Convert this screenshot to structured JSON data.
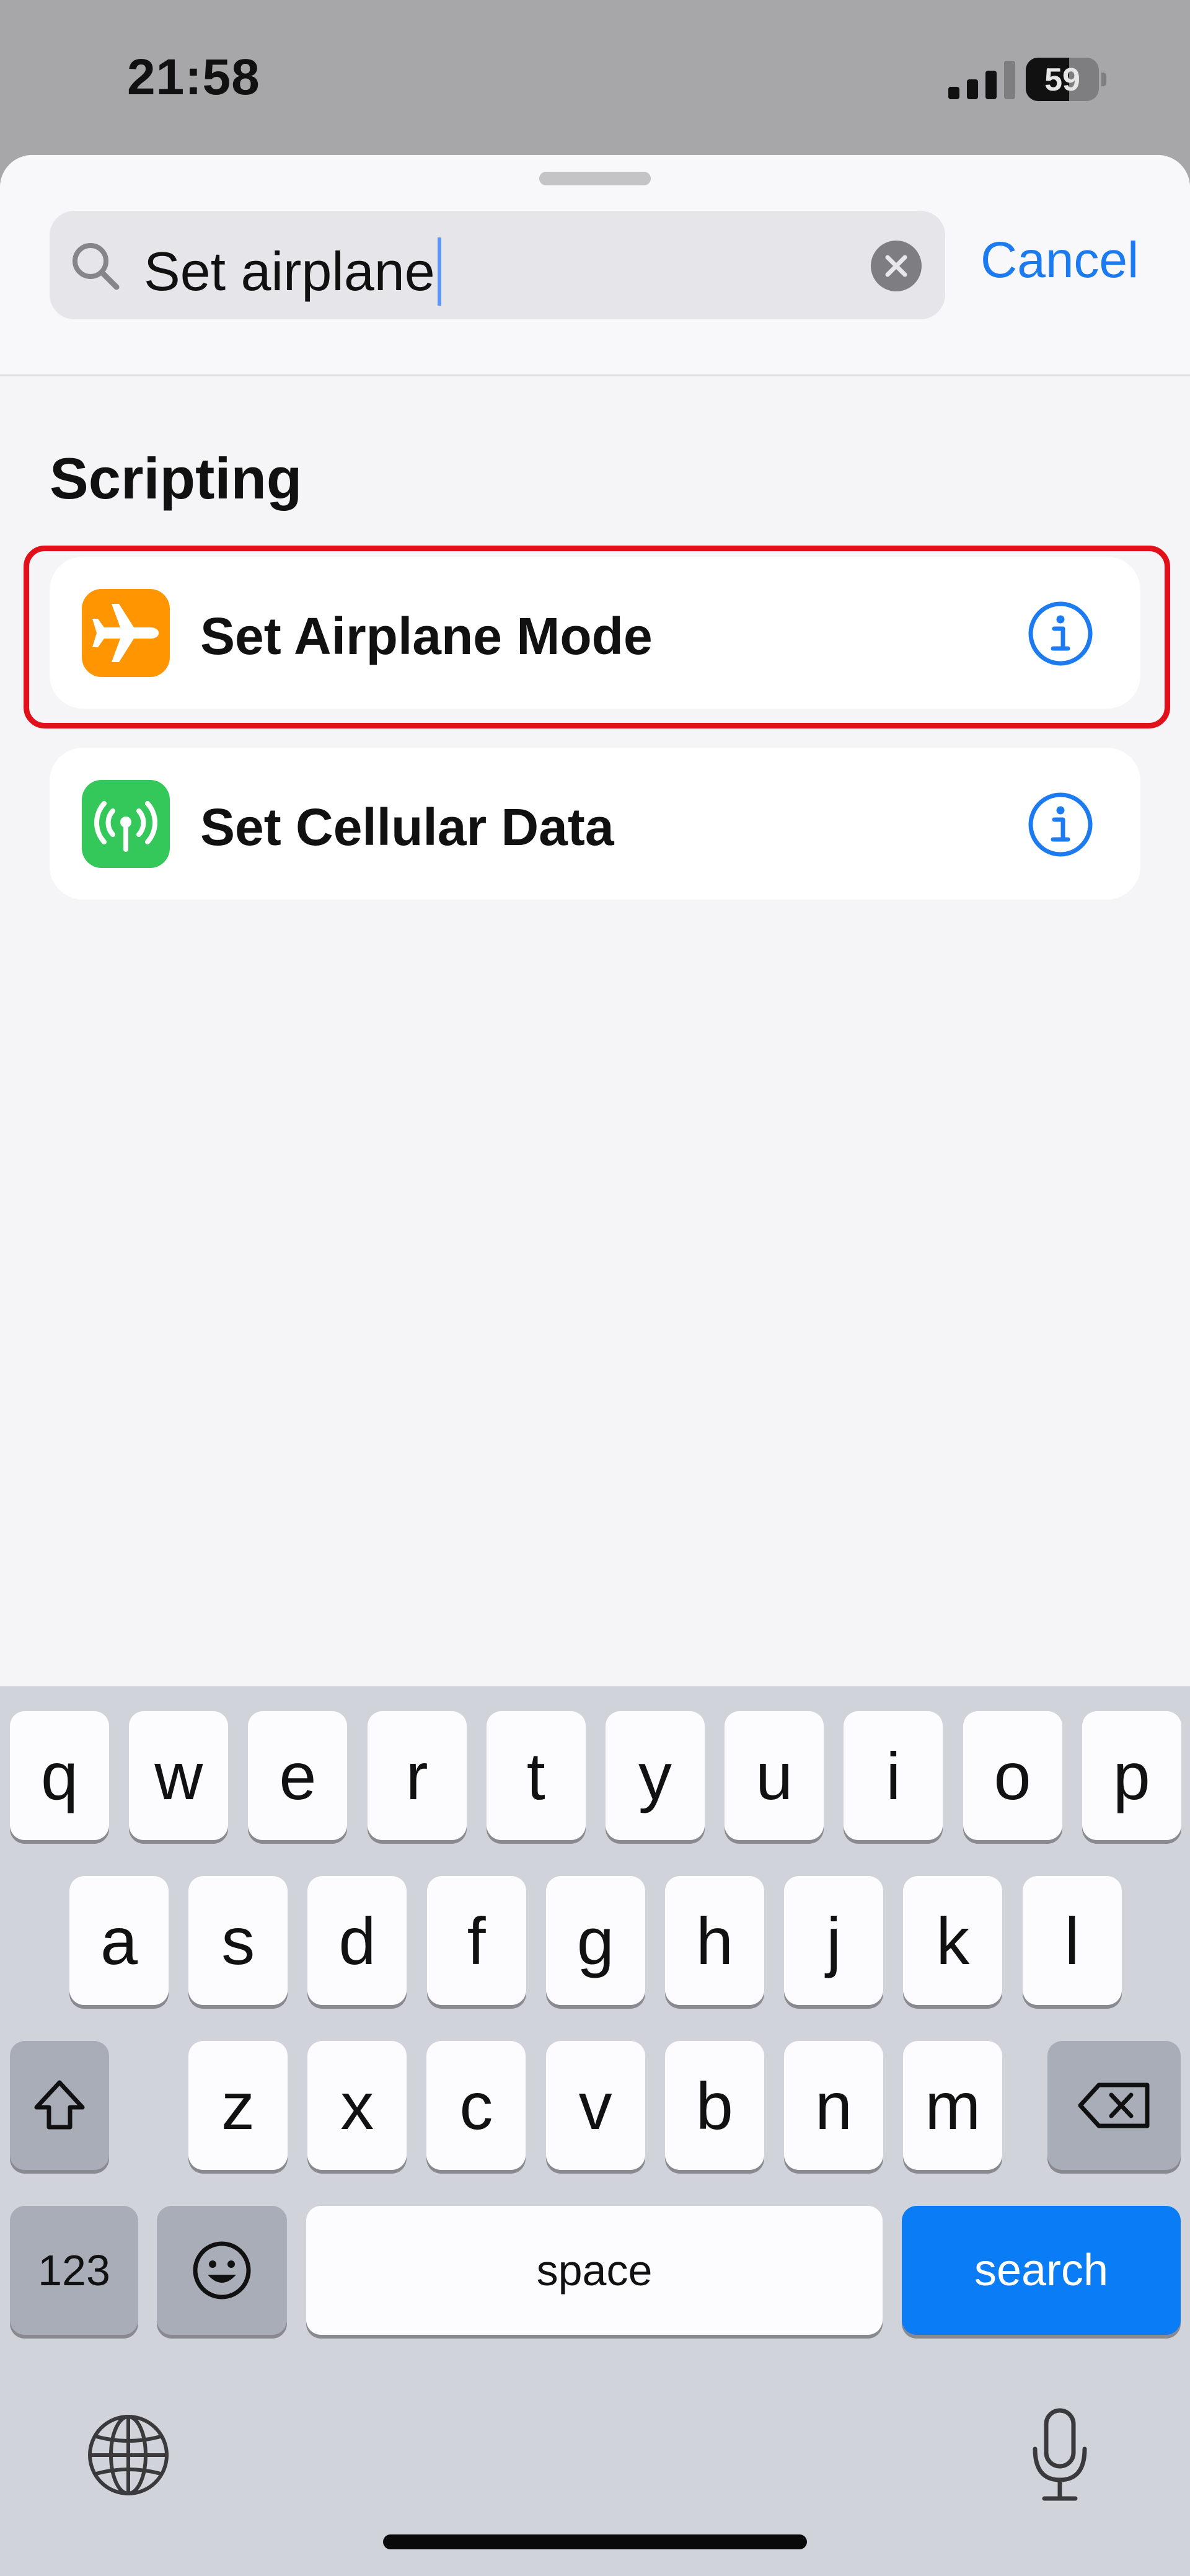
{
  "status_bar": {
    "time": "21:58",
    "battery_level": "59",
    "battery_fraction": 0.59
  },
  "search": {
    "query": "Set airplane",
    "cancel_label": "Cancel"
  },
  "results": {
    "section_title": "Scripting",
    "items": [
      {
        "label": "Set Airplane Mode",
        "icon": "airplane-icon",
        "icon_color": "#ff9500",
        "highlighted": true
      },
      {
        "label": "Set Cellular Data",
        "icon": "antenna-icon",
        "icon_color": "#34c759",
        "highlighted": false
      }
    ]
  },
  "keyboard": {
    "row1": [
      "q",
      "w",
      "e",
      "r",
      "t",
      "y",
      "u",
      "i",
      "o",
      "p"
    ],
    "row2": [
      "a",
      "s",
      "d",
      "f",
      "g",
      "h",
      "j",
      "k",
      "l"
    ],
    "row3": [
      "z",
      "x",
      "c",
      "v",
      "b",
      "n",
      "m"
    ],
    "numbers_label": "123",
    "space_label": "space",
    "search_label": "search"
  },
  "colors": {
    "accent": "#1c7bf0",
    "highlight_border": "#e2101a",
    "search_key": "#0a7cf5"
  }
}
